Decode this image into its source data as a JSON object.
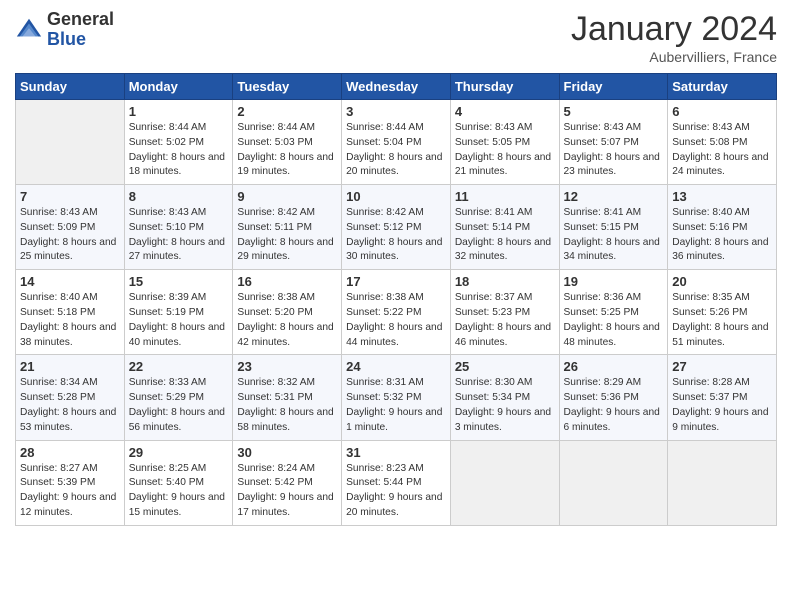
{
  "logo": {
    "general": "General",
    "blue": "Blue"
  },
  "title": "January 2024",
  "subtitle": "Aubervilliers, France",
  "days_of_week": [
    "Sunday",
    "Monday",
    "Tuesday",
    "Wednesday",
    "Thursday",
    "Friday",
    "Saturday"
  ],
  "weeks": [
    [
      {
        "day": "",
        "sunrise": "",
        "sunset": "",
        "daylight": ""
      },
      {
        "day": "1",
        "sunrise": "Sunrise: 8:44 AM",
        "sunset": "Sunset: 5:02 PM",
        "daylight": "Daylight: 8 hours and 18 minutes."
      },
      {
        "day": "2",
        "sunrise": "Sunrise: 8:44 AM",
        "sunset": "Sunset: 5:03 PM",
        "daylight": "Daylight: 8 hours and 19 minutes."
      },
      {
        "day": "3",
        "sunrise": "Sunrise: 8:44 AM",
        "sunset": "Sunset: 5:04 PM",
        "daylight": "Daylight: 8 hours and 20 minutes."
      },
      {
        "day": "4",
        "sunrise": "Sunrise: 8:43 AM",
        "sunset": "Sunset: 5:05 PM",
        "daylight": "Daylight: 8 hours and 21 minutes."
      },
      {
        "day": "5",
        "sunrise": "Sunrise: 8:43 AM",
        "sunset": "Sunset: 5:07 PM",
        "daylight": "Daylight: 8 hours and 23 minutes."
      },
      {
        "day": "6",
        "sunrise": "Sunrise: 8:43 AM",
        "sunset": "Sunset: 5:08 PM",
        "daylight": "Daylight: 8 hours and 24 minutes."
      }
    ],
    [
      {
        "day": "7",
        "sunrise": "Sunrise: 8:43 AM",
        "sunset": "Sunset: 5:09 PM",
        "daylight": "Daylight: 8 hours and 25 minutes."
      },
      {
        "day": "8",
        "sunrise": "Sunrise: 8:43 AM",
        "sunset": "Sunset: 5:10 PM",
        "daylight": "Daylight: 8 hours and 27 minutes."
      },
      {
        "day": "9",
        "sunrise": "Sunrise: 8:42 AM",
        "sunset": "Sunset: 5:11 PM",
        "daylight": "Daylight: 8 hours and 29 minutes."
      },
      {
        "day": "10",
        "sunrise": "Sunrise: 8:42 AM",
        "sunset": "Sunset: 5:12 PM",
        "daylight": "Daylight: 8 hours and 30 minutes."
      },
      {
        "day": "11",
        "sunrise": "Sunrise: 8:41 AM",
        "sunset": "Sunset: 5:14 PM",
        "daylight": "Daylight: 8 hours and 32 minutes."
      },
      {
        "day": "12",
        "sunrise": "Sunrise: 8:41 AM",
        "sunset": "Sunset: 5:15 PM",
        "daylight": "Daylight: 8 hours and 34 minutes."
      },
      {
        "day": "13",
        "sunrise": "Sunrise: 8:40 AM",
        "sunset": "Sunset: 5:16 PM",
        "daylight": "Daylight: 8 hours and 36 minutes."
      }
    ],
    [
      {
        "day": "14",
        "sunrise": "Sunrise: 8:40 AM",
        "sunset": "Sunset: 5:18 PM",
        "daylight": "Daylight: 8 hours and 38 minutes."
      },
      {
        "day": "15",
        "sunrise": "Sunrise: 8:39 AM",
        "sunset": "Sunset: 5:19 PM",
        "daylight": "Daylight: 8 hours and 40 minutes."
      },
      {
        "day": "16",
        "sunrise": "Sunrise: 8:38 AM",
        "sunset": "Sunset: 5:20 PM",
        "daylight": "Daylight: 8 hours and 42 minutes."
      },
      {
        "day": "17",
        "sunrise": "Sunrise: 8:38 AM",
        "sunset": "Sunset: 5:22 PM",
        "daylight": "Daylight: 8 hours and 44 minutes."
      },
      {
        "day": "18",
        "sunrise": "Sunrise: 8:37 AM",
        "sunset": "Sunset: 5:23 PM",
        "daylight": "Daylight: 8 hours and 46 minutes."
      },
      {
        "day": "19",
        "sunrise": "Sunrise: 8:36 AM",
        "sunset": "Sunset: 5:25 PM",
        "daylight": "Daylight: 8 hours and 48 minutes."
      },
      {
        "day": "20",
        "sunrise": "Sunrise: 8:35 AM",
        "sunset": "Sunset: 5:26 PM",
        "daylight": "Daylight: 8 hours and 51 minutes."
      }
    ],
    [
      {
        "day": "21",
        "sunrise": "Sunrise: 8:34 AM",
        "sunset": "Sunset: 5:28 PM",
        "daylight": "Daylight: 8 hours and 53 minutes."
      },
      {
        "day": "22",
        "sunrise": "Sunrise: 8:33 AM",
        "sunset": "Sunset: 5:29 PM",
        "daylight": "Daylight: 8 hours and 56 minutes."
      },
      {
        "day": "23",
        "sunrise": "Sunrise: 8:32 AM",
        "sunset": "Sunset: 5:31 PM",
        "daylight": "Daylight: 8 hours and 58 minutes."
      },
      {
        "day": "24",
        "sunrise": "Sunrise: 8:31 AM",
        "sunset": "Sunset: 5:32 PM",
        "daylight": "Daylight: 9 hours and 1 minute."
      },
      {
        "day": "25",
        "sunrise": "Sunrise: 8:30 AM",
        "sunset": "Sunset: 5:34 PM",
        "daylight": "Daylight: 9 hours and 3 minutes."
      },
      {
        "day": "26",
        "sunrise": "Sunrise: 8:29 AM",
        "sunset": "Sunset: 5:36 PM",
        "daylight": "Daylight: 9 hours and 6 minutes."
      },
      {
        "day": "27",
        "sunrise": "Sunrise: 8:28 AM",
        "sunset": "Sunset: 5:37 PM",
        "daylight": "Daylight: 9 hours and 9 minutes."
      }
    ],
    [
      {
        "day": "28",
        "sunrise": "Sunrise: 8:27 AM",
        "sunset": "Sunset: 5:39 PM",
        "daylight": "Daylight: 9 hours and 12 minutes."
      },
      {
        "day": "29",
        "sunrise": "Sunrise: 8:25 AM",
        "sunset": "Sunset: 5:40 PM",
        "daylight": "Daylight: 9 hours and 15 minutes."
      },
      {
        "day": "30",
        "sunrise": "Sunrise: 8:24 AM",
        "sunset": "Sunset: 5:42 PM",
        "daylight": "Daylight: 9 hours and 17 minutes."
      },
      {
        "day": "31",
        "sunrise": "Sunrise: 8:23 AM",
        "sunset": "Sunset: 5:44 PM",
        "daylight": "Daylight: 9 hours and 20 minutes."
      },
      {
        "day": "",
        "sunrise": "",
        "sunset": "",
        "daylight": ""
      },
      {
        "day": "",
        "sunrise": "",
        "sunset": "",
        "daylight": ""
      },
      {
        "day": "",
        "sunrise": "",
        "sunset": "",
        "daylight": ""
      }
    ]
  ]
}
